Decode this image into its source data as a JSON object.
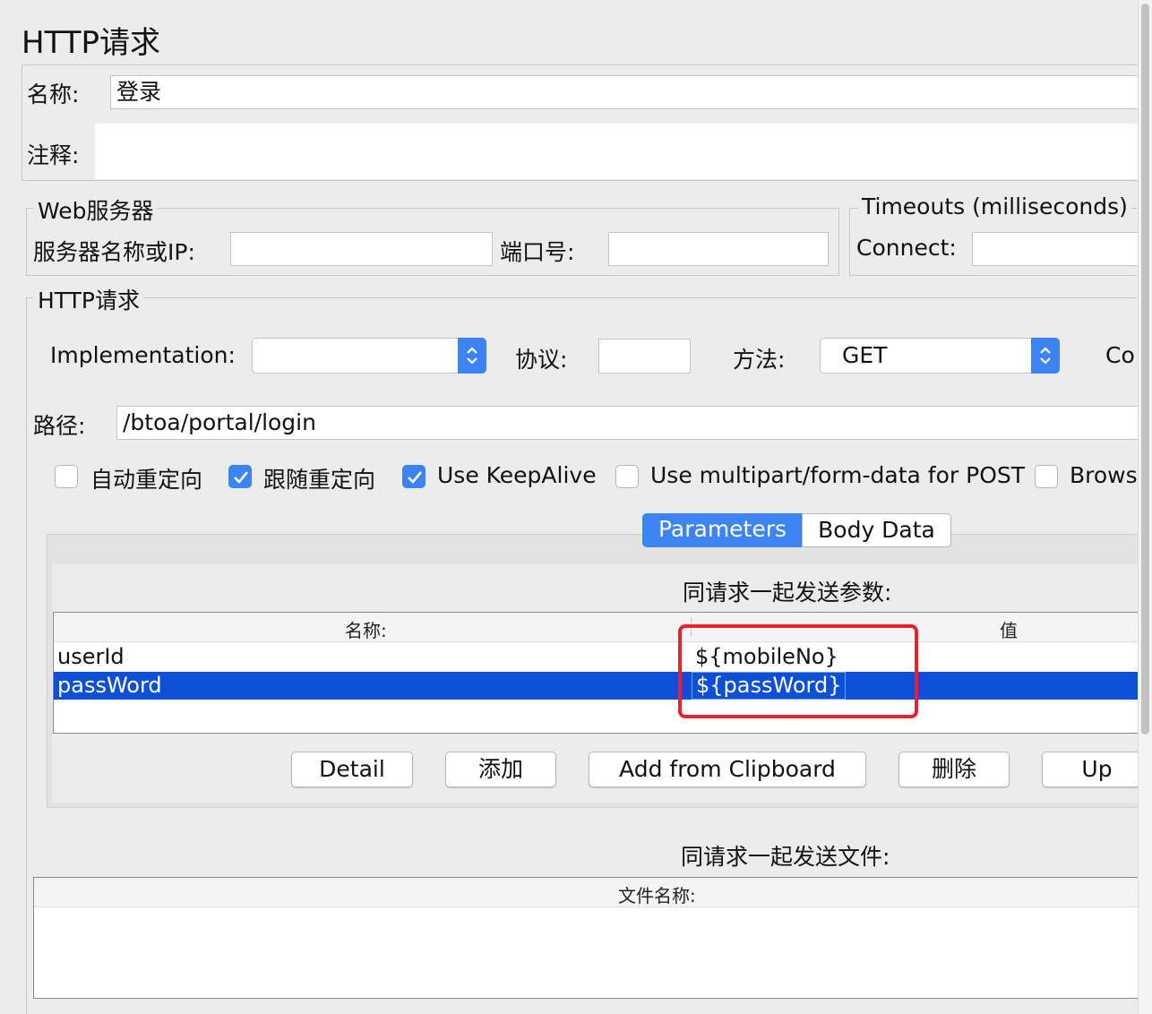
{
  "header": {
    "title": "HTTP请求"
  },
  "name_field": {
    "label": "名称:",
    "value": "登录"
  },
  "comment_field": {
    "label": "注释:",
    "value": ""
  },
  "web_server": {
    "legend": "Web服务器",
    "server_label": "服务器名称或IP:",
    "server_value": "",
    "port_label": "端口号:",
    "port_value": ""
  },
  "timeouts": {
    "legend": "Timeouts (milliseconds)",
    "connect_label": "Connect:",
    "connect_value": ""
  },
  "http_request": {
    "legend": "HTTP请求",
    "implementation_label": "Implementation:",
    "implementation_value": "",
    "protocol_label": "协议:",
    "protocol_value": "",
    "method_label": "方法:",
    "method_value": "GET",
    "content_encoding_partial": "Co",
    "path_label": "路径:",
    "path_value": "/btoa/portal/login"
  },
  "options": [
    {
      "label": "自动重定向",
      "checked": false
    },
    {
      "label": "跟随重定向",
      "checked": true
    },
    {
      "label": "Use KeepAlive",
      "checked": true
    },
    {
      "label": "Use multipart/form-data for POST",
      "checked": false
    },
    {
      "label": "Brows",
      "checked": false
    }
  ],
  "tabs": [
    {
      "label": "Parameters",
      "active": true
    },
    {
      "label": "Body Data",
      "active": false
    }
  ],
  "params": {
    "caption": "同请求一起发送参数:",
    "columns": [
      "名称:",
      "值"
    ],
    "rows": [
      {
        "name": "userId",
        "value": "${mobileNo}",
        "selected": false
      },
      {
        "name": "passWord",
        "value": "${passWord}",
        "selected": true
      }
    ]
  },
  "buttons": {
    "detail": "Detail",
    "add": "添加",
    "add_clipboard": "Add from Clipboard",
    "delete": "删除",
    "up": "Up"
  },
  "files": {
    "caption": "同请求一起发送文件:",
    "columns": [
      "文件名称:"
    ]
  },
  "colors": {
    "accent": "#3d84f3",
    "selection": "#0d50d6",
    "highlight_box": "#e8212a"
  }
}
